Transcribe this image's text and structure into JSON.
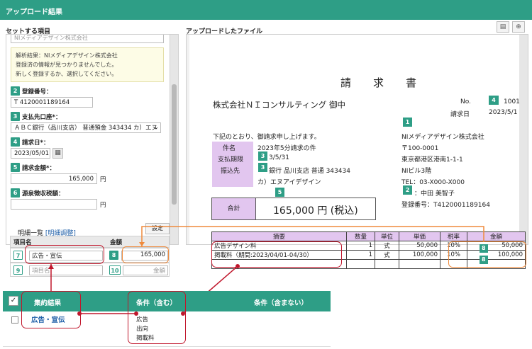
{
  "window": {
    "title": "アップロード結果"
  },
  "left_section": {
    "title": "セットする項目",
    "top_field_cut": "NIメディアデザイン株式会社",
    "info_lines": [
      "解析結果：NIメディアデザイン株式会社",
      "登録済の情報が見つかりませんでした。",
      "新しく登録するか、選択してください。"
    ],
    "fields": [
      {
        "num": "2",
        "label": "登録番号：",
        "value": "T 4120001189164"
      },
      {
        "num": "3",
        "label": "支払先口座*：",
        "value": "ＡＢＣ銀行（品川支店） 普通預金 343434 カ）エヌ"
      },
      {
        "num": "4",
        "label": "請求日*：",
        "value": "2023/05/01"
      },
      {
        "num": "5",
        "label": "請求金額*：",
        "value": "165,000",
        "unit": "円"
      },
      {
        "num": "6",
        "label": "源泉徴収税額：",
        "value": "",
        "unit": "円"
      }
    ],
    "detail": {
      "title": "明細一覧",
      "link": "[明細調整]",
      "settings_button": "設定",
      "headers": [
        "項目名",
        "金額"
      ],
      "rows": [
        {
          "num_a": "7",
          "name": "広告・宣伝",
          "num_b": "8",
          "amount": "165,000"
        },
        {
          "num_a": "9",
          "name": "項目名",
          "num_b": "10",
          "amount": "金額"
        }
      ]
    }
  },
  "right_section": {
    "title": "アップロードしたファイル",
    "tools": [
      "book-icon",
      "zoom-icon"
    ]
  },
  "invoice": {
    "title": "請　求　書",
    "to": "株式会社ＮＩコンサルティング 御中",
    "no_label": "No.",
    "no_value": "1001",
    "date_label": "請求日",
    "date_value": "2023/5/1",
    "intro": "下記のとおり、御請求申し上げます。",
    "left_labels": [
      "件名",
      "支払期限",
      "振込先"
    ],
    "subject": "2023年5分請求の件",
    "due": "3/5/31",
    "bank_1": "銀行 品川支店 普通 343434",
    "bank_2": "カ）エヌアイデザイン",
    "issuer": [
      "NIメディアデザイン株式会社",
      "〒100-0001",
      "東京都港区港南1-1-1",
      "NIビル3階",
      "TEL：03-X000-X000",
      "：中田 美智子",
      "登録番号：T4120001189164"
    ],
    "total_label": "合計",
    "total_value": "165,000 円 (税込)",
    "table": {
      "headers": [
        "摘要",
        "数量",
        "単位",
        "単価",
        "税率",
        "金額"
      ],
      "rows": [
        [
          "広告デザイン料",
          "1",
          "式",
          "50,000",
          "10%",
          "50,000"
        ],
        [
          "掲載料（期間:2023/04/01-04/30）",
          "1",
          "式",
          "100,000",
          "10%",
          "100,000"
        ],
        [
          "",
          "",
          "",
          "",
          "",
          ""
        ]
      ]
    },
    "tags": {
      "t1": "1",
      "t2": "2",
      "t3": "3",
      "t4": "4",
      "t5": "5",
      "t8": "8"
    }
  },
  "collection_table": {
    "check": "✓",
    "headers": [
      "集約結果",
      "条件（含む）",
      "条件（含まない）"
    ],
    "row": {
      "result": "広告・宣伝",
      "include": [
        "広告",
        "出向",
        "掲載料"
      ]
    }
  },
  "colors": {
    "teal": "#2e9e86",
    "purple": "#e2c6ef",
    "red": "#c0172c",
    "orange": "#ef8a3c"
  }
}
